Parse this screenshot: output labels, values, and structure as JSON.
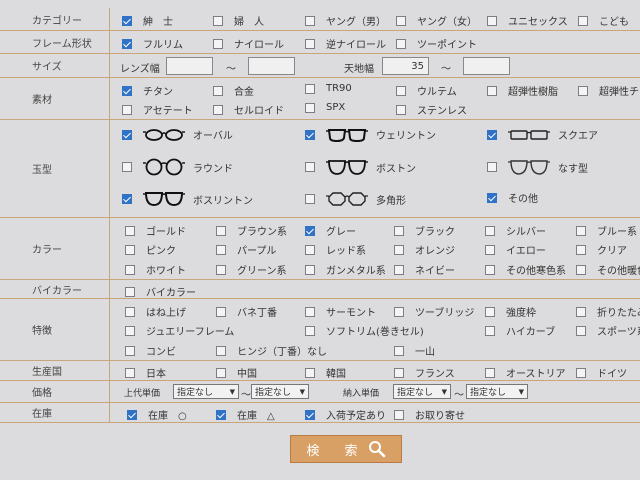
{
  "rows": {
    "category": {
      "label": "カテゴリー",
      "options": [
        {
          "label": "紳　士",
          "checked": true
        },
        {
          "label": "婦　人",
          "checked": false
        },
        {
          "label": "ヤング（男）",
          "checked": false
        },
        {
          "label": "ヤング（女）",
          "checked": false
        },
        {
          "label": "ユニセックス",
          "checked": false
        },
        {
          "label": "こども",
          "checked": false
        }
      ]
    },
    "frame_shape": {
      "label": "フレーム形状",
      "options": [
        {
          "label": "フルリム",
          "checked": true
        },
        {
          "label": "ナイロール",
          "checked": false
        },
        {
          "label": "逆ナイロール",
          "checked": false
        },
        {
          "label": "ツーポイント",
          "checked": false
        }
      ]
    },
    "size": {
      "label": "サイズ",
      "lens_width_label": "レンズ幅",
      "lens_from": "",
      "tilde1": "〜",
      "lens_to": "",
      "height_label": "天地幅",
      "height_from": "35",
      "tilde2": "〜",
      "height_to": ""
    },
    "material": {
      "label": "素材",
      "options": [
        {
          "label": "チタン",
          "checked": true
        },
        {
          "label": "合金",
          "checked": false
        },
        {
          "label": "TR90",
          "checked": false
        },
        {
          "label": "ウルテム",
          "checked": false
        },
        {
          "label": "超弾性樹脂",
          "checked": false
        },
        {
          "label": "超弾性チタ",
          "checked": false
        },
        {
          "label": "アセテート",
          "checked": false
        },
        {
          "label": "セルロイド",
          "checked": false
        },
        {
          "label": "SPX",
          "checked": false
        },
        {
          "label": "ステンレス",
          "checked": false
        }
      ]
    },
    "shape": {
      "label": "玉型",
      "options": [
        {
          "label": "オーバル",
          "checked": true,
          "icon": "oval-glasses-icon"
        },
        {
          "label": "ウェリントン",
          "checked": true,
          "icon": "wellington-glasses-icon"
        },
        {
          "label": "スクエア",
          "checked": true,
          "icon": "square-glasses-icon"
        },
        {
          "label": "ラウンド",
          "checked": false,
          "icon": "round-glasses-icon"
        },
        {
          "label": "ボストン",
          "checked": false,
          "icon": "boston-glasses-icon"
        },
        {
          "label": "なす型",
          "checked": false,
          "icon": "teardrop-glasses-icon"
        },
        {
          "label": "ボスリントン",
          "checked": true,
          "icon": "boslington-glasses-icon"
        },
        {
          "label": "多角形",
          "checked": false,
          "icon": "polygon-glasses-icon"
        },
        {
          "label": "その他",
          "checked": true,
          "icon": ""
        }
      ]
    },
    "color": {
      "label": "カラー",
      "options": [
        {
          "label": "ゴールド",
          "checked": false
        },
        {
          "label": "ブラウン系",
          "checked": false
        },
        {
          "label": "グレー",
          "checked": true
        },
        {
          "label": "ブラック",
          "checked": false
        },
        {
          "label": "シルバー",
          "checked": false
        },
        {
          "label": "ブルー系",
          "checked": false
        },
        {
          "label": "ピンク",
          "checked": false
        },
        {
          "label": "パープル",
          "checked": false
        },
        {
          "label": "レッド系",
          "checked": false
        },
        {
          "label": "オレンジ",
          "checked": false
        },
        {
          "label": "イエロー",
          "checked": false
        },
        {
          "label": "クリア",
          "checked": false
        },
        {
          "label": "ホワイト",
          "checked": false
        },
        {
          "label": "グリーン系",
          "checked": false
        },
        {
          "label": "ガンメタル系",
          "checked": false
        },
        {
          "label": "ネイビー",
          "checked": false
        },
        {
          "label": "その他寒色系",
          "checked": false
        },
        {
          "label": "その他暖色",
          "checked": false
        }
      ]
    },
    "bicolor": {
      "label": "バイカラー",
      "options": [
        {
          "label": "バイカラー",
          "checked": false
        }
      ]
    },
    "feature": {
      "label": "特徴",
      "options": [
        {
          "label": "はね上げ",
          "checked": false
        },
        {
          "label": "バネ丁番",
          "checked": false
        },
        {
          "label": "サーモント",
          "checked": false
        },
        {
          "label": "ツーブリッジ",
          "checked": false
        },
        {
          "label": "強度枠",
          "checked": false
        },
        {
          "label": "折りたたみ",
          "checked": false
        },
        {
          "label": "ジュエリーフレーム",
          "checked": false
        },
        {
          "label": "ソフトリム(巻きセル)",
          "checked": false
        },
        {
          "label": "ハイカーブ",
          "checked": false
        },
        {
          "label": "スポーツ系",
          "checked": false
        },
        {
          "label": "コンビ",
          "checked": false
        },
        {
          "label": "ヒンジ（丁番）なし",
          "checked": false
        },
        {
          "label": "一山",
          "checked": false
        }
      ]
    },
    "origin": {
      "label": "生産国",
      "options": [
        {
          "label": "日本",
          "checked": false
        },
        {
          "label": "中国",
          "checked": false
        },
        {
          "label": "韓国",
          "checked": false
        },
        {
          "label": "フランス",
          "checked": false
        },
        {
          "label": "オーストリア",
          "checked": false
        },
        {
          "label": "ドイツ",
          "checked": false
        }
      ]
    },
    "price": {
      "label": "価格",
      "retail_label": "上代単価",
      "retail_from": "指定なし",
      "retail_tilde": "〜",
      "retail_to": "指定なし",
      "wholesale_label": "納入単価",
      "wholesale_from": "指定なし",
      "wholesale_tilde": "〜",
      "wholesale_to": "指定なし"
    },
    "stock": {
      "label": "在庫",
      "options": [
        {
          "label": "在庫　○",
          "checked": true
        },
        {
          "label": "在庫　△",
          "checked": true
        },
        {
          "label": "入荷予定あり",
          "checked": true
        },
        {
          "label": "お取り寄せ",
          "checked": false
        }
      ]
    }
  },
  "search_button": {
    "label": "検　索",
    "icon": "magnifier-icon"
  },
  "colors": {
    "accent": "#2f72c6",
    "divider": "#c8a679",
    "button": "#d9a066"
  }
}
